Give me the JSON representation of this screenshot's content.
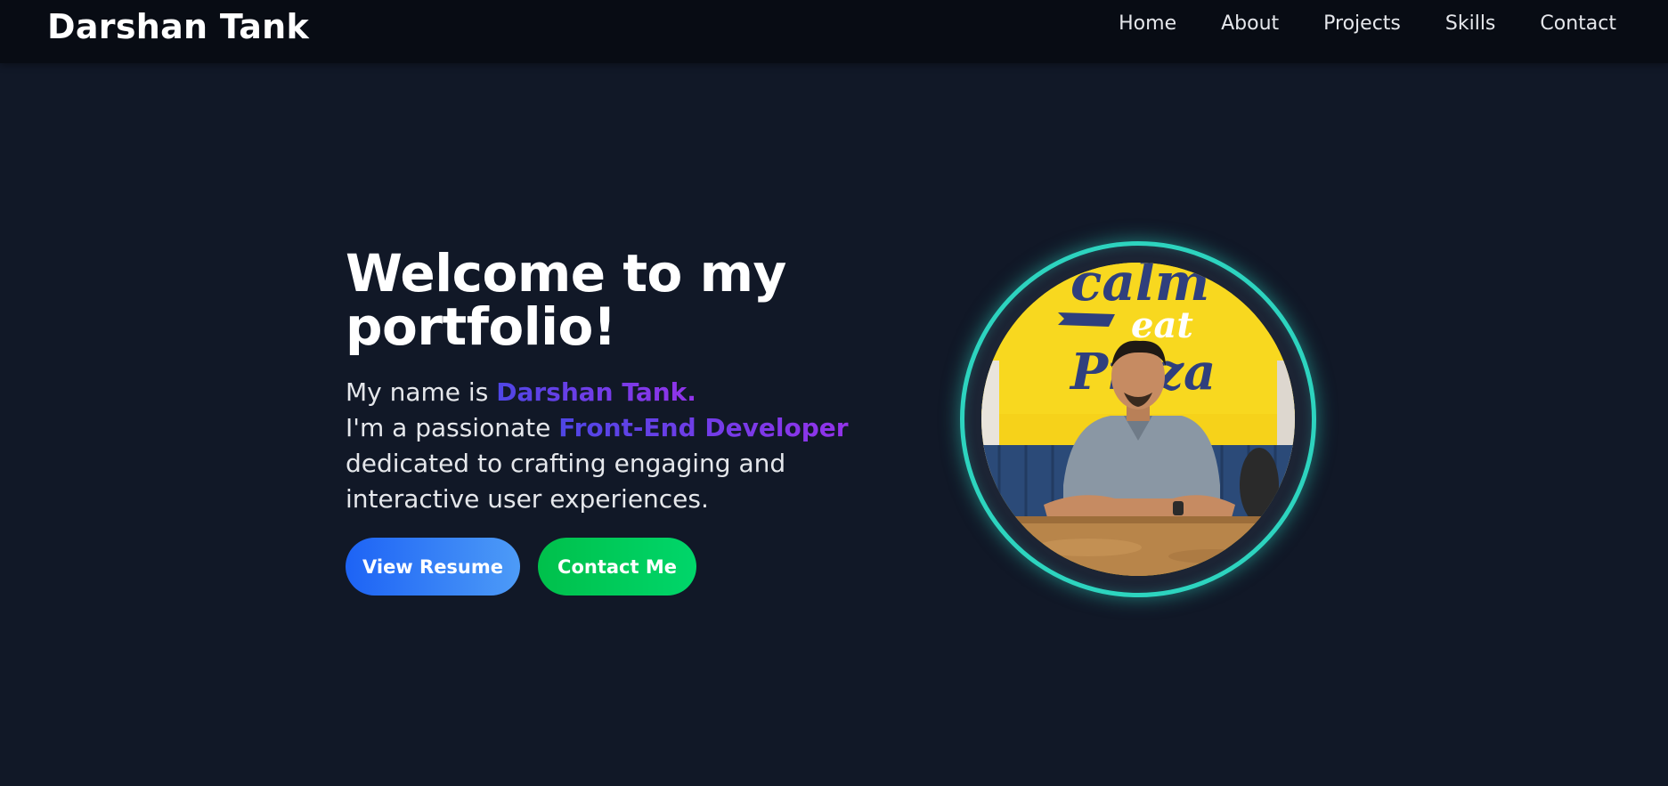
{
  "brand": {
    "name": "Darshan Tank"
  },
  "nav": {
    "items": [
      {
        "label": "Home"
      },
      {
        "label": "About"
      },
      {
        "label": "Projects"
      },
      {
        "label": "Skills"
      },
      {
        "label": "Contact"
      }
    ]
  },
  "hero": {
    "title": "Welcome to my portfolio!",
    "intro_prefix": "My name is",
    "name_highlight": "Darshan Tank.",
    "role_prefix": "I'm a passionate",
    "role_highlight": "Front-End Developer",
    "description": "dedicated to crafting engaging and interactive user experiences.",
    "buttons": {
      "resume_label": "View Resume",
      "contact_label": "Contact Me"
    }
  },
  "avatar": {
    "sign_text_top": "calm",
    "sign_text_middle": "eat",
    "sign_text_bottom": "Pizza"
  },
  "colors": {
    "background": "#111827",
    "navbar": "#080c14",
    "accent_ring": "#2dd4bf",
    "highlight_start": "#4f46e5",
    "highlight_end": "#9333ea",
    "resume_button": "#1d63f5",
    "contact_button": "#00c04b"
  }
}
